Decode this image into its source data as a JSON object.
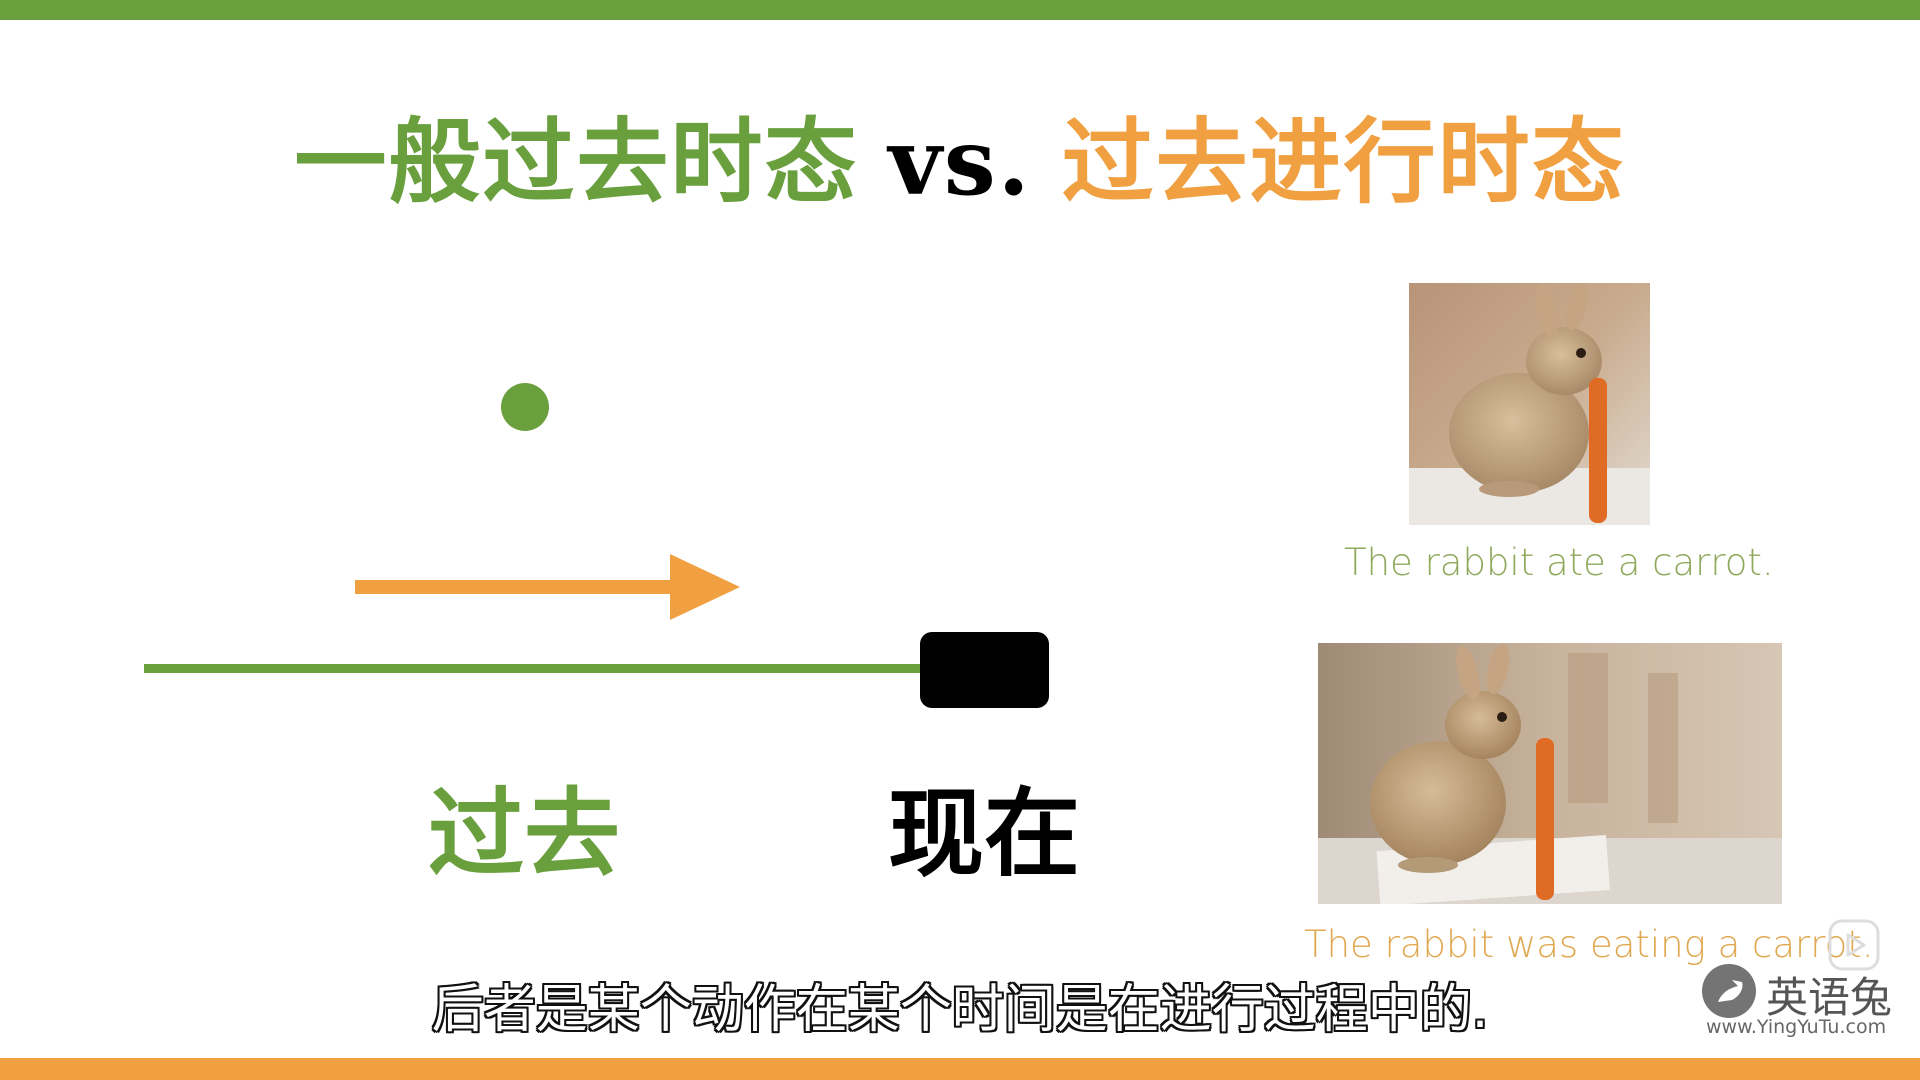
{
  "slide": {
    "title": {
      "part1": "一般过去时态",
      "vs": "vs.",
      "part2": "过去进行时态"
    },
    "timeline": {
      "past_label": "过去",
      "now_label": "现在"
    },
    "examples": [
      {
        "caption": "The rabbit ate a carrot."
      },
      {
        "caption": "The rabbit was eating a carrot."
      }
    ]
  },
  "video_subtitle": "后者是某个动作在某个时间是在进行过程中的.",
  "watermark": {
    "brand": "英语兔",
    "url": "www.YingYuTu.com"
  },
  "colors": {
    "green": "#6a9f3e",
    "orange": "#f0a040",
    "black": "#000000",
    "caption_green": "#8fa85c",
    "caption_orange": "#e0a850"
  },
  "icons": {
    "play": "play-icon",
    "logo": "rabbit-logo-icon"
  }
}
